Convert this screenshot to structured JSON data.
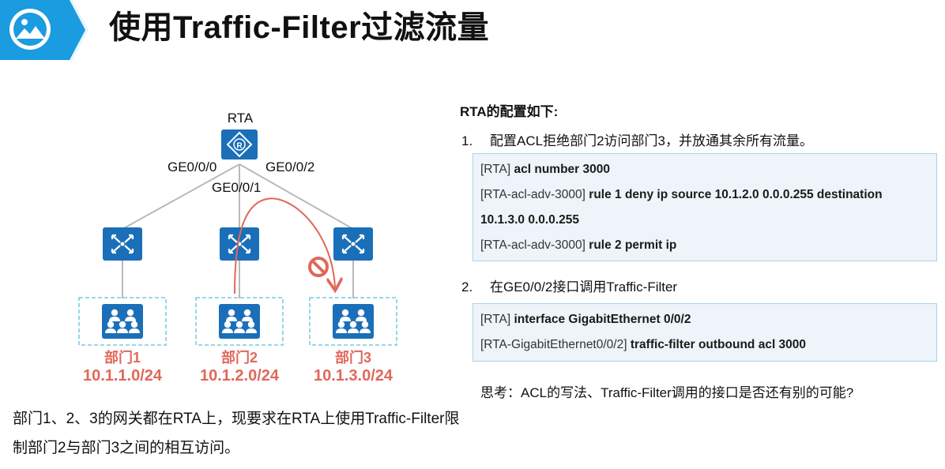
{
  "title": "使用Traffic-Filter过滤流量",
  "colors": {
    "accent_blue": "#1b9be0",
    "device_blue": "#1a6fb8",
    "dept_red": "#e0685a",
    "link_gray": "#b9b9b9"
  },
  "topology": {
    "router": {
      "label": "RTA"
    },
    "interfaces": {
      "ge0": "GE0/0/0",
      "ge1": "GE0/0/1",
      "ge2": "GE0/0/2"
    },
    "departments": [
      {
        "name": "部门1",
        "subnet": "10.1.1.0/24"
      },
      {
        "name": "部门2",
        "subnet": "10.1.2.0/24"
      },
      {
        "name": "部门3",
        "subnet": "10.1.3.0/24"
      }
    ]
  },
  "description": "部门1、2、3的网关都在RTA上，现要求在RTA上使用Traffic-Filter限制部门2与部门3之间的相互访问。",
  "config": {
    "heading": "RTA的配置如下:",
    "steps": [
      {
        "number": "1.",
        "text": "配置ACL拒绝部门2访问部门3，并放通其余所有流量。",
        "lines": [
          {
            "prompt": "[RTA]",
            "command": "acl number 3000"
          },
          {
            "prompt": "[RTA-acl-adv-3000]",
            "command": "rule 1 deny ip source 10.1.2.0 0.0.0.255 destination"
          },
          {
            "prompt": "",
            "command": "10.1.3.0 0.0.0.255"
          },
          {
            "prompt": "[RTA-acl-adv-3000]",
            "command": "rule 2 permit ip"
          }
        ]
      },
      {
        "number": "2.",
        "text": "在GE0/0/2接口调用Traffic-Filter",
        "lines": [
          {
            "prompt": "[RTA]",
            "command": "interface GigabitEthernet 0/0/2"
          },
          {
            "prompt": "[RTA-GigabitEthernet0/0/2]",
            "command": "traffic-filter outbound acl 3000"
          }
        ]
      }
    ]
  },
  "think": "思考：ACL的写法、Traffic-Filter调用的接口是否还有别的可能?"
}
